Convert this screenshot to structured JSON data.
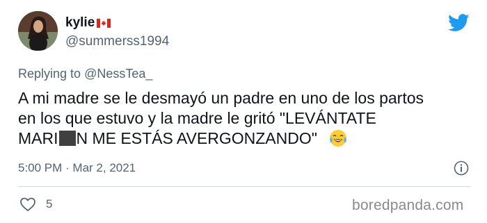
{
  "author": {
    "display_name": "kylie",
    "flag": "canada-flag-icon",
    "handle": "@summerss1994"
  },
  "reply": {
    "prefix": "Replying to ",
    "mention": "@NessTea_"
  },
  "tweet": {
    "line1": "A mi madre se le desmayó un padre en uno de los partos",
    "line2": "en los que estuvo y la madre le gritó \"LEVÁNTATE",
    "line3_before": "MARI",
    "line3_after": "N ME ESTÁS AVERGONZANDO\"",
    "emoji": "face-with-tears-of-joy-emoji"
  },
  "meta": {
    "timestamp": "5:00 PM · Mar 2, 2021"
  },
  "engagement": {
    "likes": "5"
  },
  "watermark": "boredpanda.com",
  "colors": {
    "twitter_blue": "#1d9bf0",
    "secondary_text": "#536471",
    "primary_text": "#0f1419"
  }
}
